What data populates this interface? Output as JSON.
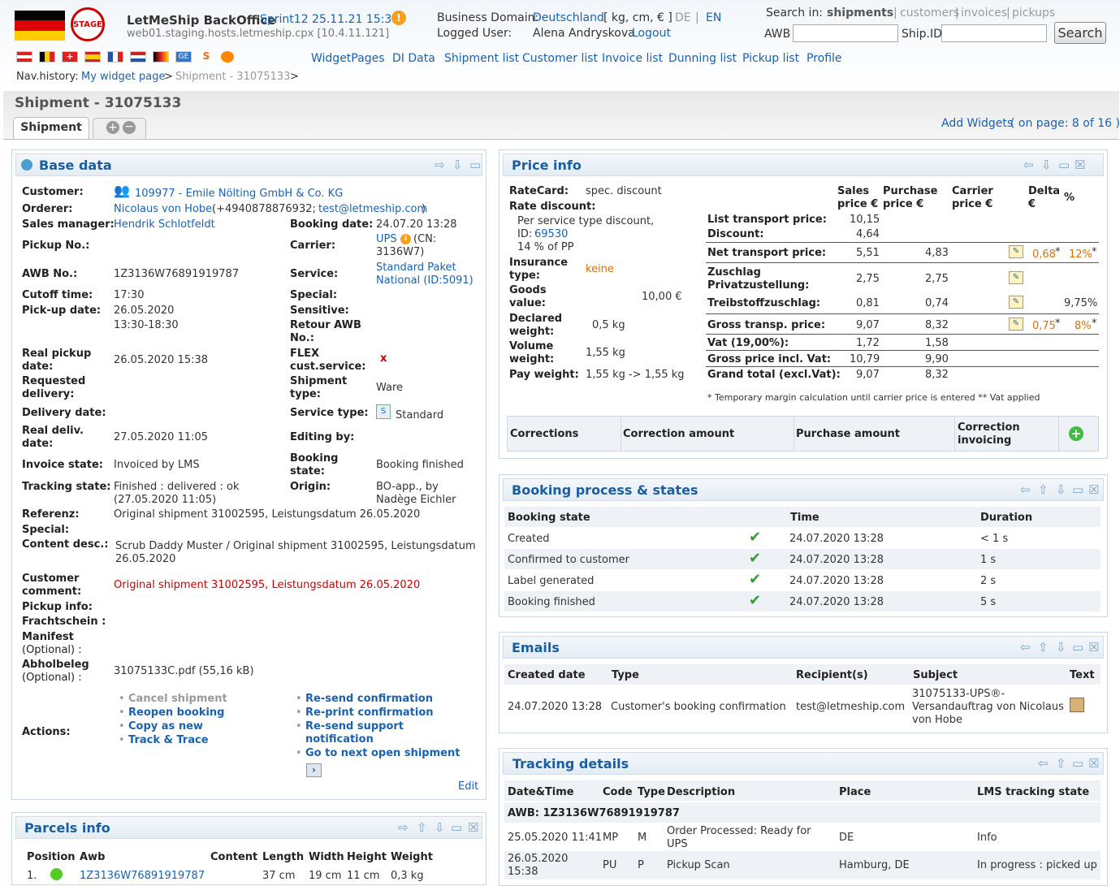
{
  "header": {
    "stage": "STAGE",
    "app_title": "LetMeShip BackOffice",
    "sprint": "Sprint12 25.11.21 15:31",
    "host": "web01.staging.hosts.letmeship.cpx [10.4.11.121]",
    "business_domain_label": "Business Domain:",
    "business_domain": "Deutschland",
    "units": "[ kg, cm, € ]",
    "lang_de": "DE",
    "lang_sep": "|",
    "lang_en": "EN",
    "logged_user_label": "Logged User:",
    "logged_user": "Alena Andryskova",
    "logout": "Logout",
    "search_in_label": "Search in:",
    "search_targets": {
      "shipments": "shipments",
      "customers": "customers",
      "invoices": "invoices",
      "pickups": "pickups",
      "sep": "|"
    },
    "awb_label": "AWB",
    "shipid_label": "Ship.ID",
    "search_button": "Search",
    "nav": [
      "WidgetPages",
      "DI Data",
      "Shipment list",
      "Customer list",
      "Invoice list",
      "Dunning list",
      "Pickup list",
      "Profile"
    ],
    "navhistory_label": "Nav.history:",
    "navhistory_link": "My widget page",
    "navhistory_current": "Shipment - 31075133",
    "navhistory_sep": ">"
  },
  "page": {
    "title": "Shipment - 31075133",
    "tab": "Shipment",
    "add_widgets": "Add Widgets",
    "on_page": "( on page: 8 of 16 )"
  },
  "base_data": {
    "title": "Base data",
    "customer_label": "Customer:",
    "customer": "109977 - Emile Nölting GmbH & Co. KG",
    "orderer_label": "Orderer:",
    "orderer": "Nicolaus von Hobe",
    "orderer_phone": "(+4940878876932;",
    "orderer_email": "test@letmeship.com",
    "orderer_close": ")",
    "sales_manager_label": "Sales manager:",
    "sales_manager": "Hendrik Schlotfeldt",
    "booking_date_label": "Booking date:",
    "booking_date": "24.07.20 13:28",
    "pickup_no_label": "Pickup No.:",
    "carrier_label": "Carrier:",
    "carrier": "UPS",
    "carrier_cn": "(CN:",
    "carrier_cn2": "3136W7)",
    "awb_no_label": "AWB No.:",
    "awb_no": "1Z3136W76891919787",
    "service_label": "Service:",
    "service": "Standard Paket",
    "service2": "National (ID:5091)",
    "cutoff_label": "Cutoff time:",
    "cutoff": "17:30",
    "special_label": "Special:",
    "pickup_date_label": "Pick-up date:",
    "pickup_date": "26.05.2020",
    "pickup_time": "13:30-18:30",
    "sensitive_label": "Sensitive:",
    "retour_label": "Retour AWB",
    "retour_label2": "No.:",
    "real_pickup_label": "Real pickup",
    "real_pickup_label2": "date:",
    "real_pickup": "26.05.2020 15:38",
    "flex_label": "FLEX",
    "flex_label2": "cust.service:",
    "flex_value": "x",
    "requested_label": "Requested",
    "requested_label2": "delivery:",
    "shipment_type_label": "Shipment",
    "shipment_type_label2": "type:",
    "shipment_type": "Ware",
    "delivery_date_label": "Delivery date:",
    "service_type_label": "Service type:",
    "service_type": "Standard",
    "real_deliv_label": "Real deliv.",
    "real_deliv_label2": "date:",
    "real_deliv": "27.05.2020 11:05",
    "editing_by_label": "Editing by:",
    "invoice_state_label": "Invoice state:",
    "invoice_state": "Invoiced by LMS",
    "booking_state_label": "Booking",
    "booking_state_label2": "state:",
    "booking_state": "Booking finished",
    "tracking_state_label": "Tracking state:",
    "tracking_state": "Finished : delivered : ok",
    "tracking_state2": "(27.05.2020 11:05)",
    "origin_label": "Origin:",
    "origin": "BO-app., by",
    "origin2": "Nadège Eichler",
    "referenz_label": "Referenz:",
    "referenz": "Original shipment 31002595, Leistungsdatum 26.05.2020",
    "special2_label": "Special:",
    "content_label": "Content desc.:",
    "content": "Scrub Daddy Muster / Original shipment 31002595, Leistungsdatum",
    "content2": "26.05.2020",
    "cust_comment_label": "Customer",
    "cust_comment_label2": "comment:",
    "cust_comment": "Original shipment 31002595, Leistungsdatum 26.05.2020",
    "pickup_info_label": "Pickup info:",
    "frachtschein_label": "Frachtschein :",
    "manifest_label": "Manifest",
    "manifest_label2": "(Optional) :",
    "abholbeleg_label": "Abholbeleg",
    "abholbeleg_label2": "(Optional) :",
    "abholbeleg": "31075133C.pdf (55,16 kB)",
    "actions_label": "Actions:",
    "actions_left": [
      "Cancel shipment",
      "Reopen booking",
      "Copy as new",
      "Track & Trace"
    ],
    "actions_right": [
      "Re-send confirmation",
      "Re-print confirmation",
      "Re-send support",
      "notification",
      "Go to next open shipment"
    ],
    "edit": "Edit"
  },
  "parcels": {
    "title": "Parcels info",
    "headers": [
      "Position",
      "Awb",
      "Content",
      "Length",
      "Width",
      "Height",
      "Weight"
    ],
    "rows": [
      {
        "pos": "1.",
        "awb": "1Z3136W76891919787",
        "length": "37 cm",
        "width": "19 cm",
        "height": "11 cm",
        "weight": "0,3 kg"
      }
    ]
  },
  "price": {
    "title": "Price info",
    "ratecard_label": "RateCard:",
    "ratecard": "spec. discount",
    "rate_discount_label": "Rate discount:",
    "per_service": "Per service type discount,",
    "id_label": "ID:",
    "id": "69530",
    "pct": "14 % of PP",
    "insurance_label": "Insurance",
    "insurance_label2": "type:",
    "insurance": "keine",
    "goods_label": "Goods",
    "goods_label2": "value:",
    "goods": "10,00 €",
    "declared_label": "Declared",
    "declared_label2": "weight:",
    "declared": "0,5 kg",
    "volume_label": "Volume",
    "volume_label2": "weight:",
    "volume": "1,55 kg",
    "pay_label": "Pay weight:",
    "pay": "1,55 kg -> 1,55 kg",
    "col_sales": "Sales",
    "col_sales2": "price €",
    "col_purchase": "Purchase",
    "col_purchase2": "price €",
    "col_carrier": "Carrier",
    "col_carrier2": "price €",
    "col_delta": "Delta",
    "col_delta2": "€",
    "col_pct": "%",
    "rows": [
      {
        "label": "List transport price:",
        "sales": "10,15",
        "purchase": ""
      },
      {
        "label": "Discount:",
        "sales": "4,64",
        "purchase": ""
      },
      {
        "label": "Net transport price:",
        "sales": "5,51",
        "purchase": "4,83",
        "delta": "0,68",
        "pct": "12%"
      },
      {
        "label": "Zuschlag",
        "label2": "Privatzustellung:",
        "sales": "2,75",
        "purchase": "2,75"
      },
      {
        "label": "Treibstoffzuschlag:",
        "sales": "0,81",
        "purchase": "0,74",
        "pct": "9,75%"
      },
      {
        "label": "Gross transp. price:",
        "sales": "9,07",
        "purchase": "8,32",
        "delta": "0,75",
        "pct": "8%"
      },
      {
        "label": "Vat (19,00%):",
        "sales": "1,72",
        "purchase": "1,58"
      },
      {
        "label": "Gross price incl. Vat:",
        "sales": "10,79",
        "purchase": "9,90"
      },
      {
        "label": "Grand total (excl.Vat):",
        "sales": "9,07",
        "purchase": "8,32"
      }
    ],
    "star": "*",
    "footnote": "* Temporary margin calculation until carrier price is entered ** Vat applied",
    "corr_headers": [
      "Corrections",
      "Correction amount",
      "Purchase amount",
      "Correction",
      "invoicing"
    ]
  },
  "booking": {
    "title": "Booking process & states",
    "headers": [
      "Booking state",
      "Time",
      "Duration"
    ],
    "rows": [
      {
        "state": "Created",
        "time": "24.07.2020 13:28",
        "duration": "< 1 s"
      },
      {
        "state": "Confirmed to customer",
        "time": "24.07.2020 13:28",
        "duration": "1 s"
      },
      {
        "state": "Label generated",
        "time": "24.07.2020 13:28",
        "duration": "2 s"
      },
      {
        "state": "Booking finished",
        "time": "24.07.2020 13:28",
        "duration": "5 s"
      }
    ]
  },
  "emails": {
    "title": "Emails",
    "headers": [
      "Created date",
      "Type",
      "Recipient(s)",
      "Subject",
      "Text"
    ],
    "row": {
      "date": "24.07.2020 13:28",
      "type": "Customer's booking confirmation",
      "recipient": "test@letmeship.com",
      "subject1": "31075133-UPS®-",
      "subject2": "Versandauftrag von Nicolaus",
      "subject3": "von Hobe"
    }
  },
  "tracking": {
    "title": "Tracking details",
    "headers": [
      "Date&Time",
      "Code",
      "Type",
      "Description",
      "Place",
      "LMS tracking state"
    ],
    "awb_line": "AWB: 1Z3136W76891919787",
    "rows": [
      {
        "dt": "25.05.2020 11:41",
        "dt2": "",
        "code": "MP",
        "type": "M",
        "desc": "Order Processed: Ready for",
        "desc2": "UPS",
        "place": "DE",
        "state": "Info"
      },
      {
        "dt": "26.05.2020",
        "dt2": "15:38",
        "code": "PU",
        "type": "P",
        "desc": "Pickup Scan",
        "desc2": "",
        "place": "Hamburg, DE",
        "state": "In progress : picked up"
      }
    ]
  },
  "colors": {
    "accent": "#1b5ea0",
    "link": "#1a62b0",
    "orange": "#e07000",
    "red": "#c00000",
    "ok": "#3a9a3a"
  }
}
